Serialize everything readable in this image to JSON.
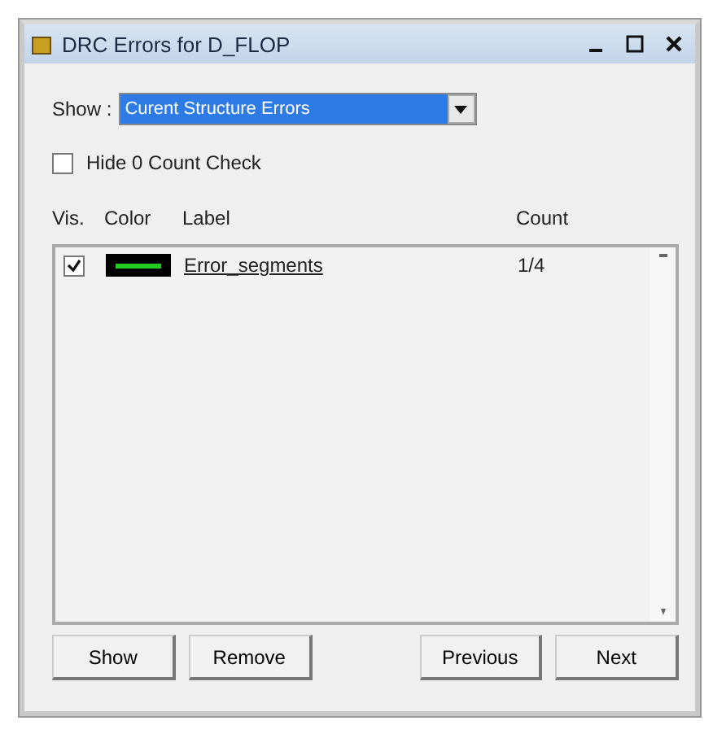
{
  "window": {
    "title": "DRC Errors for D_FLOP"
  },
  "show": {
    "label": "Show :",
    "value": "Curent Structure Errors"
  },
  "hide_zero": {
    "label": "Hide 0 Count Check",
    "checked": false
  },
  "columns": [
    "Vis.",
    "Color",
    "Label",
    "Count"
  ],
  "rows": [
    {
      "visible": true,
      "color": "#22cc22",
      "label": "Error_segments",
      "count": "1/4"
    }
  ],
  "buttons": [
    "Show",
    "Remove",
    "Previous",
    "Next"
  ]
}
